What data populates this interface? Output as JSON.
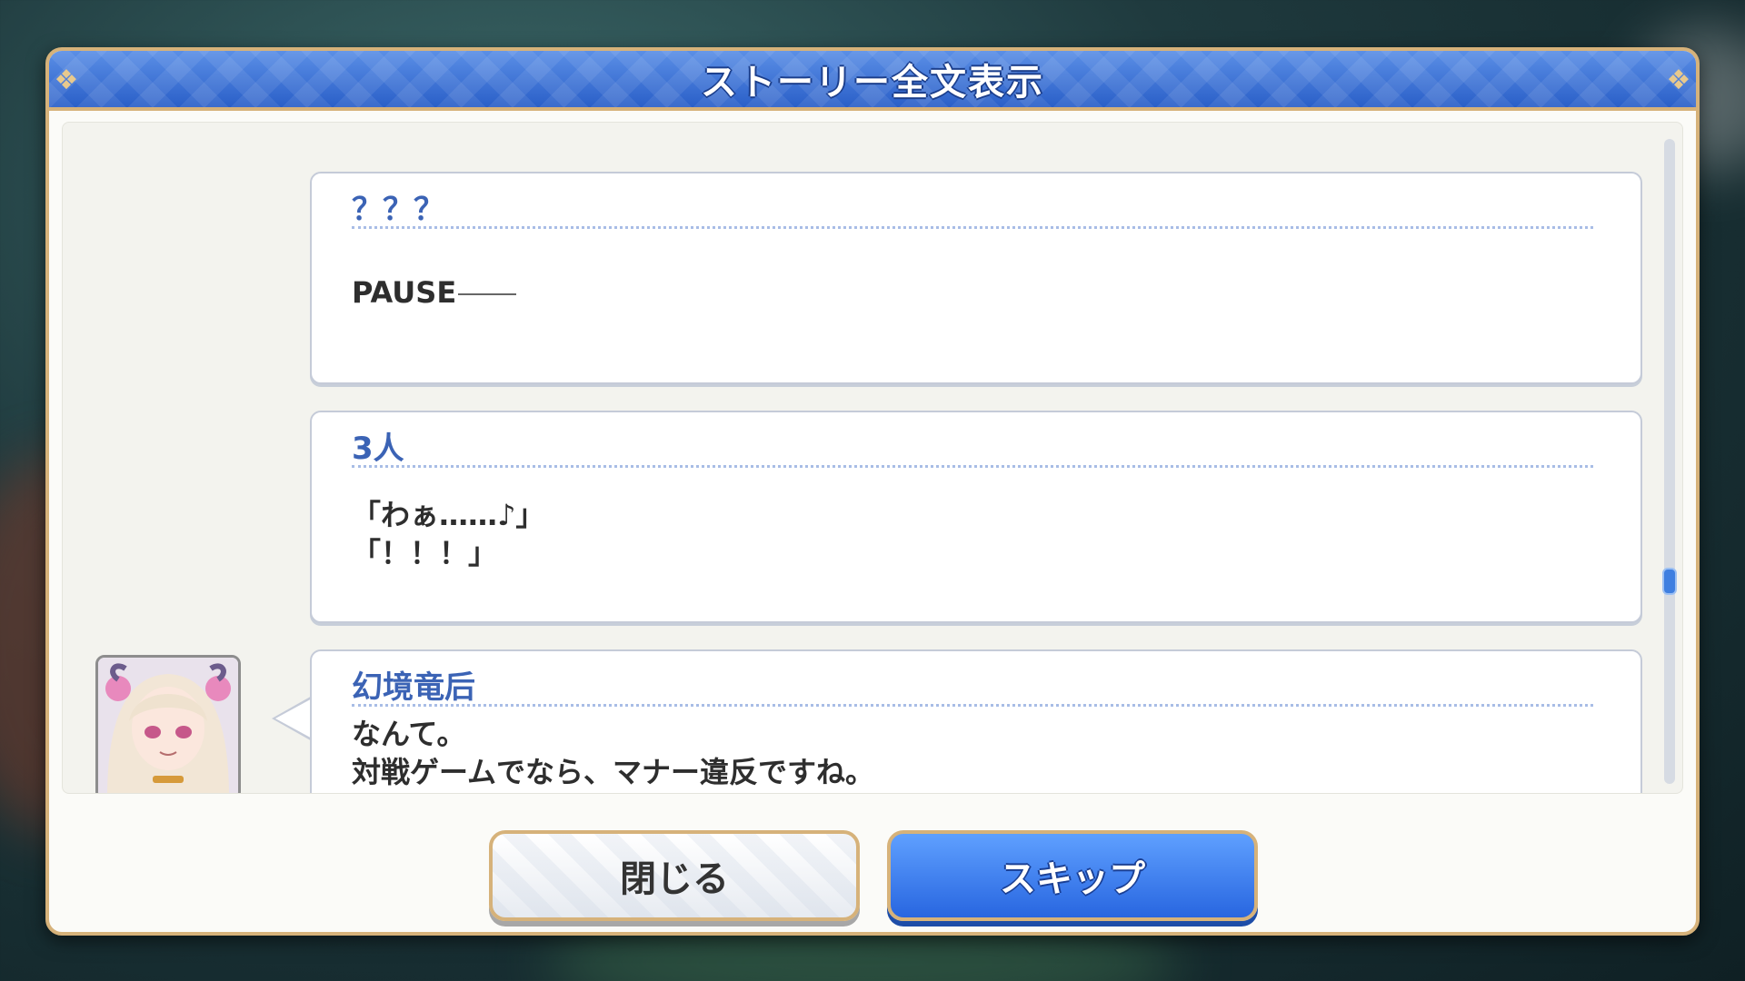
{
  "dialog": {
    "title": "ストーリー全文表示"
  },
  "log": [
    {
      "speaker": "？？？",
      "text": "PAUSE"
    },
    {
      "speaker": "3人",
      "text": "「わぁ……♪」\n「！！！」"
    },
    {
      "speaker": "幻境竜后",
      "text": "なんて。\n対戦ゲームでなら、マナー違反ですね。\nピンチのときに横やりを入れるのは。"
    }
  ],
  "buttons": {
    "close_label": "閉じる",
    "skip_label": "スキップ"
  },
  "colors": {
    "title_bar": "#2a5fc8",
    "accent_gold": "#d6b27a",
    "speaker_text": "#3b63b5",
    "skip_button": "#2866e0"
  },
  "icons": {
    "avatar": "character-portrait-icon",
    "corner": "ornament-icon"
  }
}
